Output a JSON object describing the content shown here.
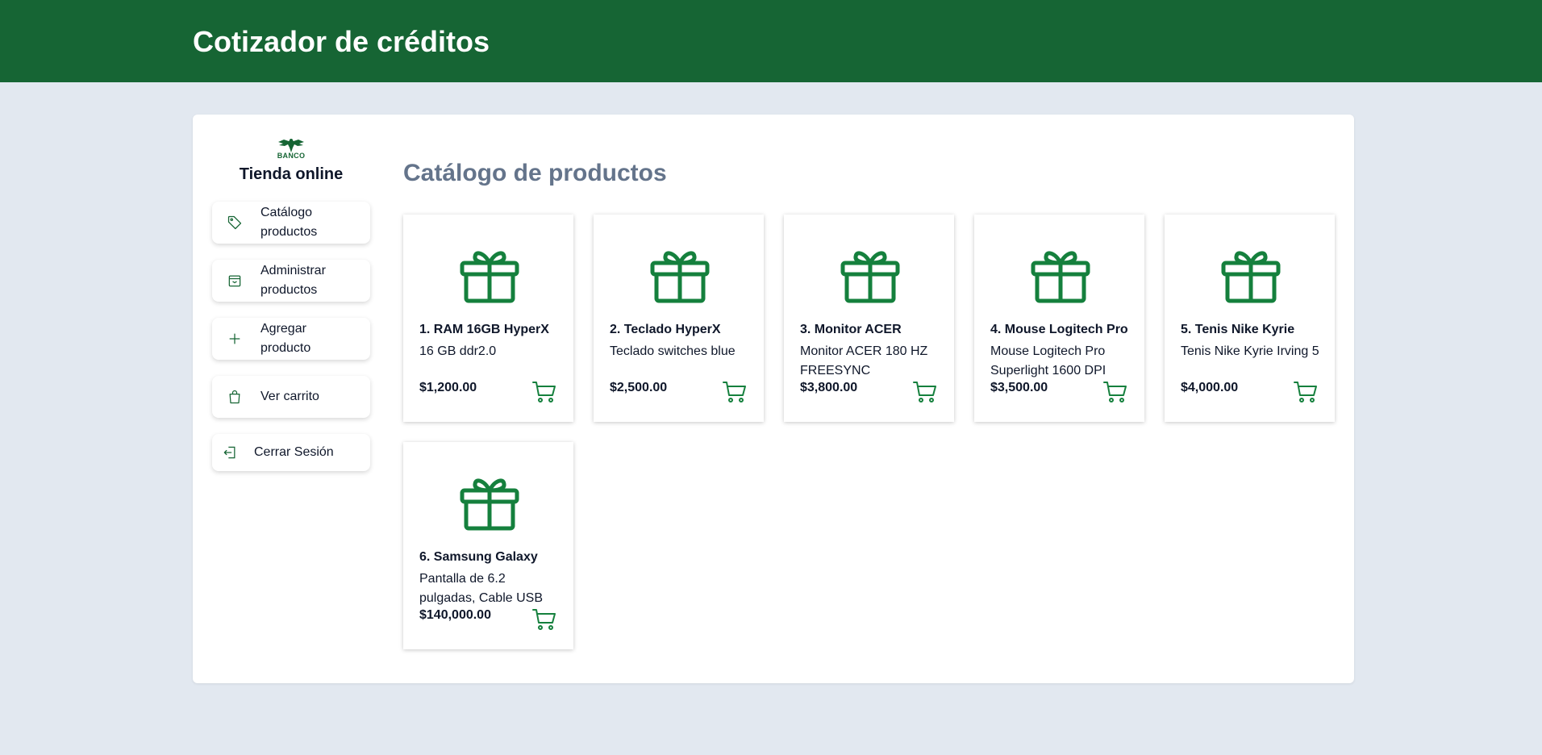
{
  "header": {
    "title": "Cotizador de créditos"
  },
  "sidebar": {
    "logo_text": "BANCO",
    "store_title": "Tienda online",
    "items": [
      {
        "label": "Catálogo productos",
        "icon": "tag-icon"
      },
      {
        "label": "Administrar productos",
        "icon": "archive-icon"
      },
      {
        "label": "Agregar producto",
        "icon": "plus-icon"
      },
      {
        "label": "Ver carrito",
        "icon": "shopping-bag-icon"
      },
      {
        "label": "Cerrar Sesión",
        "icon": "logout-icon"
      }
    ]
  },
  "main": {
    "title": "Catálogo de productos",
    "products": [
      {
        "name": "1. RAM 16GB HyperX",
        "description": "16 GB ddr2.0",
        "price": "$1,200.00"
      },
      {
        "name": "2. Teclado HyperX",
        "description": "Teclado switches blue",
        "price": "$2,500.00"
      },
      {
        "name": "3. Monitor ACER",
        "description": "Monitor ACER 180 HZ FREESYNC",
        "price": "$3,800.00"
      },
      {
        "name": "4. Mouse Logitech Pro",
        "description": "Mouse Logitech Pro Superlight 1600 DPI",
        "price": "$3,500.00"
      },
      {
        "name": "5. Tenis Nike Kyrie",
        "description": "Tenis Nike Kyrie Irving 5",
        "price": "$4,000.00"
      },
      {
        "name": "6. Samsung Galaxy",
        "description": "Pantalla de 6.2 pulgadas, Cable USB",
        "price": "$140,000.00"
      }
    ]
  },
  "colors": {
    "brand": "#166534",
    "icon_green": "#15803d",
    "background": "#e2e8f0",
    "heading": "#64748b"
  }
}
